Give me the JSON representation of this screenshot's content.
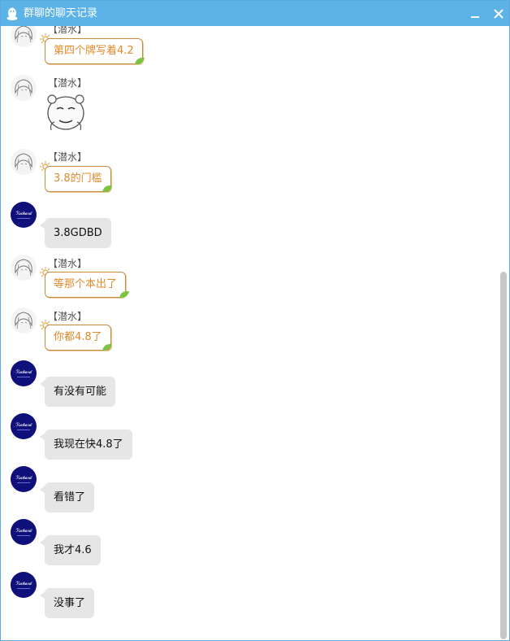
{
  "window": {
    "title": "群聊的聊天记录",
    "min_label": "–",
    "close_label": "✕",
    "title_bar_color": "#5cb3e8"
  },
  "messages": [
    {
      "sender": "【潜水】",
      "text": "第四个牌写着4.2",
      "style": "orange"
    },
    {
      "sender": "【潜水】",
      "text": "",
      "style": "sticker"
    },
    {
      "sender": "【潜水】",
      "text": "3.8的门槛",
      "style": "orange"
    },
    {
      "sender": "",
      "text": "3.8GDBD",
      "style": "gray"
    },
    {
      "sender": "【潜水】",
      "text": "等那个本出了",
      "style": "orange"
    },
    {
      "sender": "【潜水】",
      "text": "你都4.8了",
      "style": "orange"
    },
    {
      "sender": "",
      "text": "有没有可能",
      "style": "gray"
    },
    {
      "sender": "",
      "text": "我现在快4.8了",
      "style": "gray"
    },
    {
      "sender": "",
      "text": "看错了",
      "style": "gray"
    },
    {
      "sender": "",
      "text": "我才4.6",
      "style": "gray"
    },
    {
      "sender": "",
      "text": "没事了",
      "style": "gray"
    }
  ]
}
